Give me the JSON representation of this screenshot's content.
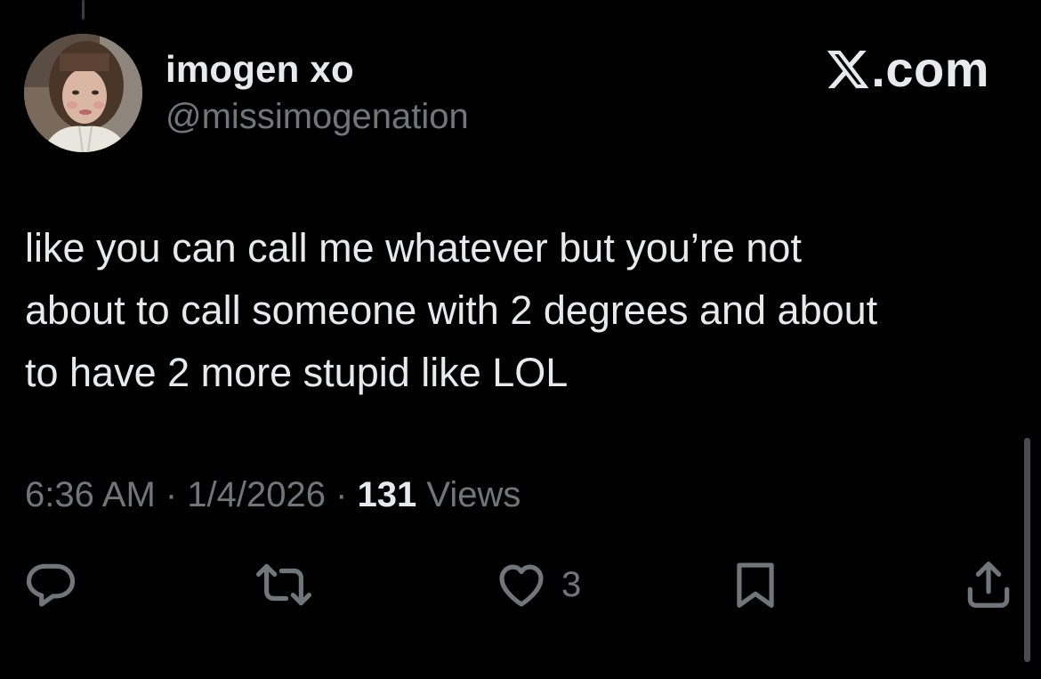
{
  "author": {
    "display_name": "imogen xo",
    "handle": "@missimogenation",
    "avatar": "profile-photo"
  },
  "brand": {
    "logo_icon": "x-logo-icon",
    "text": ".com"
  },
  "tweet": {
    "lines": [
      "like you can call me whatever but you’re not",
      "about to call someone with 2 degrees and about",
      "to have 2 more stupid like LOL"
    ]
  },
  "meta": {
    "time": "6:36 AM",
    "separator": " · ",
    "date": "1/4/2026",
    "views_count": "131",
    "views_label": " Views"
  },
  "actions": {
    "reply_icon": "reply-icon",
    "retweet_icon": "retweet-icon",
    "like_icon": "heart-icon",
    "like_count": "3",
    "bookmark_icon": "bookmark-icon",
    "share_icon": "share-icon"
  },
  "colors": {
    "background": "#000000",
    "primary_text": "#e7e9ea",
    "secondary_text": "#71767b"
  }
}
